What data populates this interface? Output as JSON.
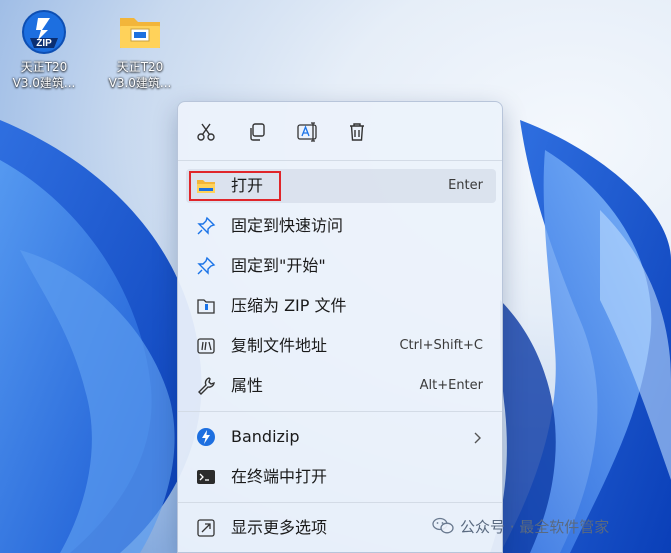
{
  "desktop": {
    "icons": [
      {
        "line1": "天正T20",
        "line2": "V3.0建筑..."
      },
      {
        "line1": "天正T20",
        "line2": "V3.0建筑..."
      }
    ],
    "zip_badge": "ZIP"
  },
  "context_menu": {
    "toolbar": [
      "cut-icon",
      "copy-icon",
      "rename-icon",
      "delete-icon"
    ],
    "items": [
      {
        "label": "打开",
        "shortcut": "Enter",
        "icon": "folder-icon"
      },
      {
        "label": "固定到快速访问",
        "shortcut": "",
        "icon": "pin-icon"
      },
      {
        "label": "固定到\"开始\"",
        "shortcut": "",
        "icon": "pin-icon"
      },
      {
        "label": "压缩为 ZIP 文件",
        "shortcut": "",
        "icon": "zip-folder-icon"
      },
      {
        "label": "复制文件地址",
        "shortcut": "Ctrl+Shift+C",
        "icon": "copy-path-icon"
      },
      {
        "label": "属性",
        "shortcut": "Alt+Enter",
        "icon": "wrench-icon"
      },
      {
        "label": "Bandizip",
        "shortcut": "",
        "icon": "bandizip-icon"
      },
      {
        "label": "在终端中打开",
        "shortcut": "",
        "icon": "terminal-icon"
      },
      {
        "label": "显示更多选项",
        "shortcut": "",
        "icon": "more-options-icon"
      }
    ]
  },
  "watermark": {
    "text": "公众号 · 最全软件管家"
  },
  "colors": {
    "highlight_border": "#e0252a",
    "accent": "#1a73e8"
  }
}
